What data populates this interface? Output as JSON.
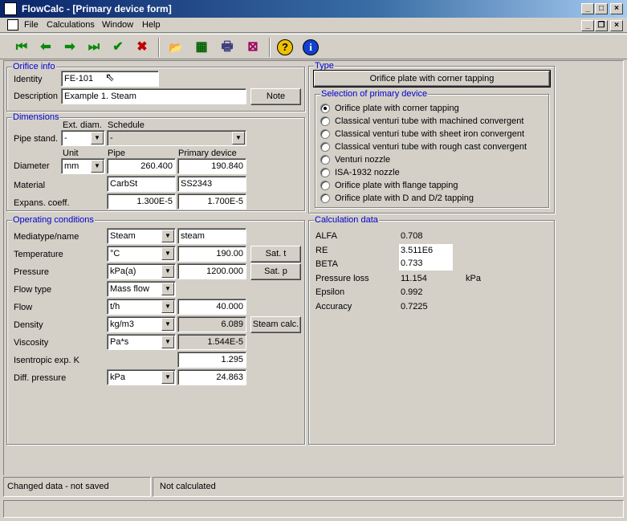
{
  "window": {
    "title": "FlowCalc - [Primary device form]"
  },
  "menu": [
    "File",
    "Calculations",
    "Window",
    "Help"
  ],
  "toolbar": {
    "first": "⏮",
    "prev": "⬅",
    "next": "➡",
    "last": "⏭",
    "accept": "✔",
    "cancel": "✖",
    "open": "📂",
    "calc": "▦",
    "print": "🖶",
    "chart": "⊠",
    "help": "?",
    "info": "i"
  },
  "orifice_info": {
    "title": "Orifice info",
    "identity_label": "Identity",
    "identity": "FE-101",
    "description_label": "Description",
    "description": "Example 1. Steam",
    "note_button": "Note"
  },
  "dimensions": {
    "title": "Dimensions",
    "ext_diam_header": "Ext. diam.",
    "schedule_header": "Schedule",
    "pipe_stand_label": "Pipe stand.",
    "pipe_stand": "-",
    "schedule": "-",
    "unit_header": "Unit",
    "pipe_header": "Pipe",
    "primary_header": "Primary device",
    "diameter_label": "Diameter",
    "diameter_unit": "mm",
    "diameter_pipe": "260.400",
    "diameter_primary": "190.840",
    "material_label": "Material",
    "material_pipe": "CarbSt",
    "material_primary": "SS2343",
    "expans_label": "Expans. coeff.",
    "expans_pipe": "1.300E-5",
    "expans_primary": "1.700E-5"
  },
  "operating": {
    "title": "Operating conditions",
    "rows": [
      {
        "label": "Mediatype/name",
        "unit": "Steam",
        "value": "steam"
      },
      {
        "label": "Temperature",
        "unit": "°C",
        "value": "190.00"
      },
      {
        "label": "Pressure",
        "unit": "kPa(a)",
        "value": "1200.000"
      },
      {
        "label": "Flow type",
        "unit": "Mass flow",
        "value": ""
      },
      {
        "label": "Flow",
        "unit": "t/h",
        "value": "40.000"
      },
      {
        "label": "Density",
        "unit": "kg/m3",
        "value": "6.089"
      },
      {
        "label": "Viscosity",
        "unit": "Pa*s",
        "value": "1.544E-5"
      },
      {
        "label": "Isentropic exp. K",
        "unit": "",
        "value": "1.295"
      },
      {
        "label": "Diff. pressure",
        "unit": "kPa",
        "value": "24.863"
      }
    ],
    "sat_t_button": "Sat. t",
    "sat_p_button": "Sat. p",
    "steam_calc_button": "Steam calc."
  },
  "type": {
    "title": "Type",
    "selected_button": "Orifice plate with corner tapping",
    "selection_title": "Selection of primary device",
    "options": [
      "Orifice plate with corner tapping",
      "Classical venturi tube with machined convergent",
      "Classical venturi tube with sheet iron convergent",
      "Classical venturi tube with rough cast convergent",
      "Venturi nozzle",
      "ISA-1932 nozzle",
      "Orifice plate with flange tapping",
      "Orifice plate with D and D/2 tapping"
    ],
    "selected_index": 0
  },
  "calc": {
    "title": "Calculation data",
    "rows": [
      {
        "label": "ALFA",
        "value": "0.708",
        "unit": ""
      },
      {
        "label": "RE",
        "value": "3.511E6",
        "unit": ""
      },
      {
        "label": "BETA",
        "value": "0.733",
        "unit": ""
      },
      {
        "label": "Pressure loss",
        "value": "11.154",
        "unit": "kPa"
      },
      {
        "label": "Epsilon",
        "value": "0.992",
        "unit": ""
      },
      {
        "label": "Accuracy",
        "value": "0.7225",
        "unit": ""
      }
    ]
  },
  "status": {
    "left": "Changed data - not saved",
    "right": "Not calculated"
  }
}
